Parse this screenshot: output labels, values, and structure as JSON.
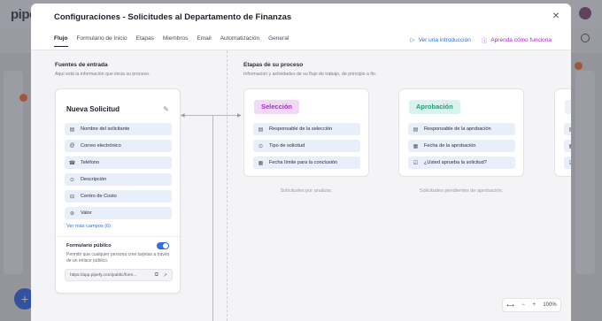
{
  "background": {
    "logo": "pipefy",
    "fab_label": "+"
  },
  "modal": {
    "title": "Configuraciones - Solicitudes al Departamento de Finanzas",
    "close_icon": "close-icon"
  },
  "tabs": [
    {
      "label": "Flujo",
      "active": true
    },
    {
      "label": "Formulario de Inicio",
      "active": false
    },
    {
      "label": "Etapas",
      "active": false
    },
    {
      "label": "Miembros",
      "active": false
    },
    {
      "label": "Email",
      "active": false
    },
    {
      "label": "Automatización",
      "active": false
    },
    {
      "label": "General",
      "active": false
    }
  ],
  "help_links": {
    "intro": {
      "label": "Ver una introducción",
      "icon": "play-icon",
      "color": "#2d6fe0"
    },
    "learn": {
      "label": "Aprenda cómo funciona",
      "icon": "question-icon",
      "color": "#a22cc4"
    }
  },
  "input_sources": {
    "title": "Fuentes de entrada",
    "subtitle": "Aquí está la información que inicia su proceso."
  },
  "form_card": {
    "title": "Nueva Solicitud",
    "fields": [
      {
        "label": "Nombre del solicitante",
        "icon": "text-icon"
      },
      {
        "label": "Correo electrónico",
        "icon": "at-icon"
      },
      {
        "label": "Teléfono",
        "icon": "phone-icon"
      },
      {
        "label": "Descripción",
        "icon": "attachment-icon"
      },
      {
        "label": "Centro de Costo",
        "icon": "select-icon"
      },
      {
        "label": "Valor",
        "icon": "currency-icon"
      }
    ],
    "more_fields": "Ver más campos (6)",
    "public_form": {
      "title": "Formulario público",
      "enabled": true,
      "description": "Permitir que cualquier persona cree tarjetas a través de un enlace público.",
      "url": "https://app.pipefy.com/public/form..."
    }
  },
  "process_stages": {
    "title": "Etapas de su proceso",
    "subtitle": "Información y actividades de su flujo de trabajo, de principio a fin."
  },
  "phases": [
    {
      "name": "Selección",
      "badge_bg": "#f3d9f8",
      "badge_color": "#a22cc4",
      "fields": [
        {
          "label": "Responsable de la selección",
          "icon": "assignee-icon"
        },
        {
          "label": "Tipo de solicitud",
          "icon": "radio-icon"
        },
        {
          "label": "Fecha límite para la conclusión",
          "icon": "calendar-icon"
        }
      ],
      "caption": "Solicitudes por analizar."
    },
    {
      "name": "Aprobación",
      "badge_bg": "#d8f3ec",
      "badge_color": "#1f9c7a",
      "fields": [
        {
          "label": "Responsable de la aprobación",
          "icon": "assignee-icon"
        },
        {
          "label": "Fecha de la aprobación",
          "icon": "calendar-icon"
        },
        {
          "label": "¿Usted aprueba la solicitud?",
          "icon": "checkbox-icon"
        }
      ],
      "caption": "Solicitudes pendientes de aprobación."
    }
  ],
  "zoom": {
    "level": "100%",
    "fit_icon": "fit-width-icon"
  }
}
